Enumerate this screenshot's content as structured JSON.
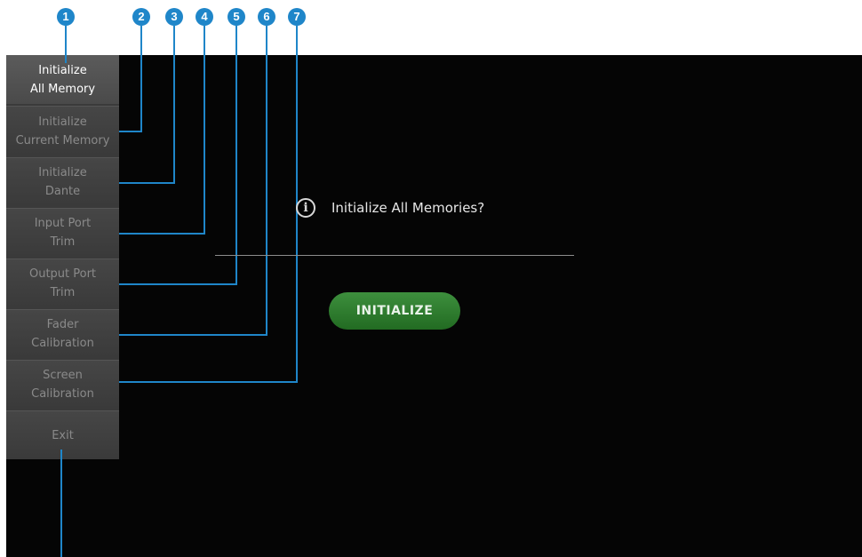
{
  "callouts": [
    "1",
    "2",
    "3",
    "4",
    "5",
    "6",
    "7"
  ],
  "menu": {
    "items": [
      {
        "line1": "Initialize",
        "line2": "All Memory"
      },
      {
        "line1": "Initialize",
        "line2": "Current Memory"
      },
      {
        "line1": "Initialize",
        "line2": "Dante"
      },
      {
        "line1": "Input Port",
        "line2": "Trim"
      },
      {
        "line1": "Output Port",
        "line2": "Trim"
      },
      {
        "line1": "Fader",
        "line2": "Calibration"
      },
      {
        "line1": "Screen",
        "line2": "Calibration"
      }
    ],
    "exit": "Exit"
  },
  "dialog": {
    "icon": "info-icon",
    "message": "Initialize All Memories?",
    "button": "INITIALIZE"
  },
  "colors": {
    "callout": "#1f86c9",
    "initialize_button": "#2f7d2f",
    "screen_background": "#050505"
  }
}
